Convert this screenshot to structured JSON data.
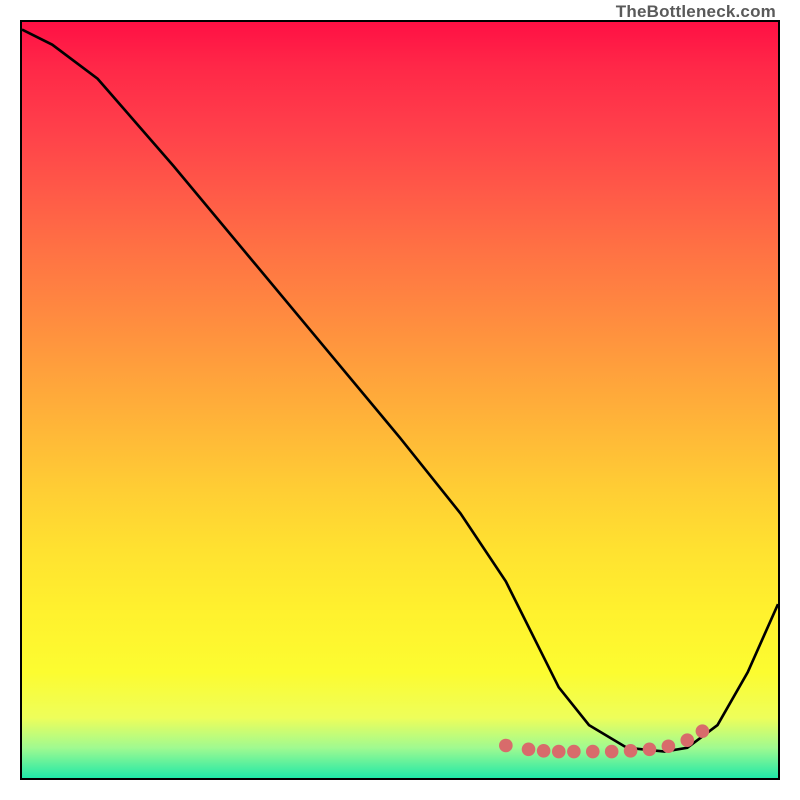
{
  "watermark": "TheBottleneck.com",
  "chart_data": {
    "type": "line",
    "title": "",
    "xlabel": "",
    "ylabel": "",
    "xlim": [
      0,
      100
    ],
    "ylim": [
      0,
      100
    ],
    "series": [
      {
        "name": "bottleneck-curve",
        "x": [
          0,
          4,
          10,
          20,
          30,
          40,
          50,
          58,
          64,
          68,
          71,
          75,
          80,
          85,
          88,
          92,
          96,
          100
        ],
        "y": [
          99,
          97,
          92.5,
          81,
          69,
          57,
          45,
          35,
          26,
          18,
          12,
          7,
          4,
          3.5,
          4,
          7,
          14,
          23
        ]
      }
    ],
    "markers": {
      "x": [
        64,
        67,
        69,
        71,
        73,
        75.5,
        78,
        80.5,
        83,
        85.5,
        88,
        90
      ],
      "y": [
        4.3,
        3.8,
        3.6,
        3.5,
        3.5,
        3.5,
        3.5,
        3.6,
        3.8,
        4.2,
        5.0,
        6.2
      ]
    },
    "colors": {
      "curve": "#000000",
      "markers": "#d86b6b",
      "gradient_top": "#ff1044",
      "gradient_bottom": "#20e8a8"
    }
  }
}
